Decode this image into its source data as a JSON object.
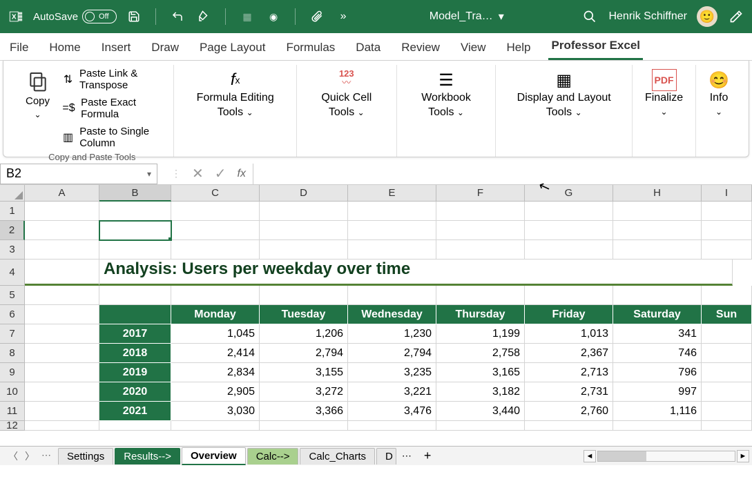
{
  "titlebar": {
    "autosave": "AutoSave",
    "autosave_off": "Off",
    "filename": "Model_Tra…",
    "username": "Henrik Schiffner"
  },
  "ribbon_tabs": [
    "File",
    "Home",
    "Insert",
    "Draw",
    "Page Layout",
    "Formulas",
    "Data",
    "Review",
    "View",
    "Help",
    "Professor Excel"
  ],
  "ribbon": {
    "copy": "Copy",
    "paste_link": "Paste Link & Transpose",
    "paste_exact": "Paste Exact Formula",
    "paste_single": "Paste to Single Column",
    "copy_group": "Copy and Paste Tools",
    "formula_tools": "Formula Editing Tools",
    "quick_cell": "Quick Cell Tools",
    "workbook": "Workbook Tools",
    "display_layout": "Display and Layout Tools",
    "finalize": "Finalize",
    "info": "Info"
  },
  "namebox": "B2",
  "fx": "fx",
  "columns": [
    "A",
    "B",
    "C",
    "D",
    "E",
    "F",
    "G",
    "H",
    "I"
  ],
  "rows": [
    "1",
    "2",
    "3",
    "4",
    "5",
    "6",
    "7",
    "8",
    "9",
    "10",
    "11",
    "12"
  ],
  "title": "Analysis: Users per weekday over time",
  "weekdays": [
    "Monday",
    "Tuesday",
    "Wednesday",
    "Thursday",
    "Friday",
    "Saturday",
    "Sun"
  ],
  "years": [
    "2017",
    "2018",
    "2019",
    "2020",
    "2021"
  ],
  "data": {
    "2017": [
      "1,045",
      "1,206",
      "1,230",
      "1,199",
      "1,013",
      "341"
    ],
    "2018": [
      "2,414",
      "2,794",
      "2,794",
      "2,758",
      "2,367",
      "746"
    ],
    "2019": [
      "2,834",
      "3,155",
      "3,235",
      "3,165",
      "2,713",
      "796"
    ],
    "2020": [
      "2,905",
      "3,272",
      "3,221",
      "3,182",
      "2,731",
      "997"
    ],
    "2021": [
      "3,030",
      "3,366",
      "3,476",
      "3,440",
      "2,760",
      "1,116"
    ]
  },
  "sheets": {
    "settings": "Settings",
    "results": "Results-->",
    "overview": "Overview",
    "calc": "Calc-->",
    "calc_charts": "Calc_Charts",
    "d": "D"
  },
  "chart_data": {
    "type": "table",
    "title": "Analysis: Users per weekday over time",
    "columns": [
      "Monday",
      "Tuesday",
      "Wednesday",
      "Thursday",
      "Friday",
      "Saturday"
    ],
    "rows": [
      "2017",
      "2018",
      "2019",
      "2020",
      "2021"
    ],
    "values": [
      [
        1045,
        1206,
        1230,
        1199,
        1013,
        341
      ],
      [
        2414,
        2794,
        2794,
        2758,
        2367,
        746
      ],
      [
        2834,
        3155,
        3235,
        3165,
        2713,
        796
      ],
      [
        2905,
        3272,
        3221,
        3182,
        2731,
        997
      ],
      [
        3030,
        3366,
        3476,
        3440,
        2760,
        1116
      ]
    ]
  }
}
